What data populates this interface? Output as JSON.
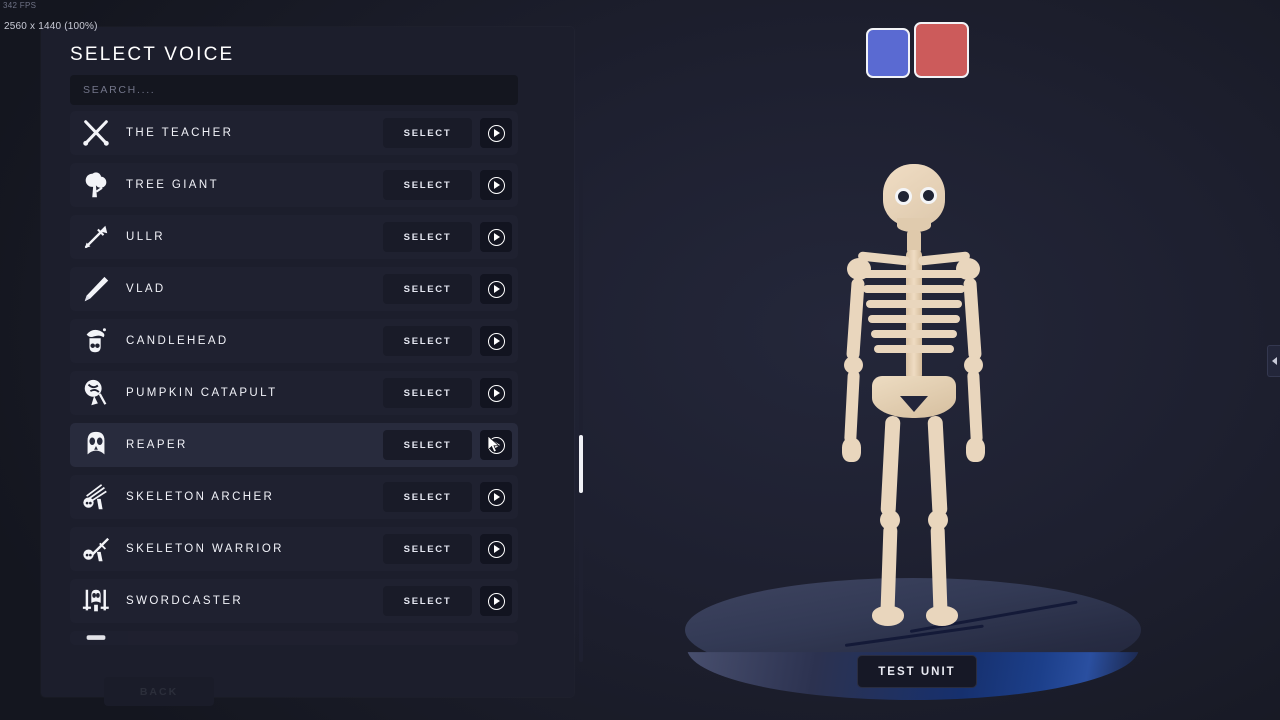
{
  "overlay": {
    "fps": "342 FPS",
    "resolution": "2560 x 1440 (100%)"
  },
  "colors": {
    "background": "#1b1d2b",
    "panel": "#1c1e2c",
    "row": "#1f2130",
    "row_active": "#282b3d",
    "accent_text": "#ffffff",
    "swatch_blue": "#5a6ad2",
    "swatch_red": "#cc5b5b",
    "bone": "#e9d6bd",
    "platform": "#39405c",
    "platform_edge": "#1c3f8a"
  },
  "swatches": [
    {
      "name": "blue",
      "color": "#5a6ad2",
      "selected": false
    },
    {
      "name": "red",
      "color": "#cc5b5b",
      "selected": true
    }
  ],
  "panel": {
    "title": "SELECT VOICE",
    "search": {
      "value": "",
      "placeholder": "SEARCH...."
    },
    "select_label": "SELECT",
    "play_label": "",
    "back_label": "BACK",
    "scroll": {
      "thumb_top_pct": 57,
      "thumb_height_pct": 11
    }
  },
  "voices": [
    {
      "name": "THE TEACHER",
      "icon": "crossed-swords-icon",
      "active": false
    },
    {
      "name": "TREE GIANT",
      "icon": "tree-icon",
      "active": false
    },
    {
      "name": "ULLR",
      "icon": "arrow-icon",
      "active": false
    },
    {
      "name": "VLAD",
      "icon": "stake-icon",
      "active": false
    },
    {
      "name": "CANDLEHEAD",
      "icon": "candle-skull-icon",
      "active": false
    },
    {
      "name": "PUMPKIN CATAPULT",
      "icon": "pumpkin-icon",
      "active": false
    },
    {
      "name": "REAPER",
      "icon": "reaper-skull-icon",
      "active": true
    },
    {
      "name": "SKELETON ARCHER",
      "icon": "skeleton-bow-icon",
      "active": false
    },
    {
      "name": "SKELETON WARRIOR",
      "icon": "skeleton-sword-icon",
      "active": false
    },
    {
      "name": "SWORDCASTER",
      "icon": "swordcaster-icon",
      "active": false
    }
  ],
  "viewport": {
    "test_unit_label": "TEST UNIT",
    "model": "skeleton",
    "side_tab_icon": "chevron-left-icon"
  }
}
